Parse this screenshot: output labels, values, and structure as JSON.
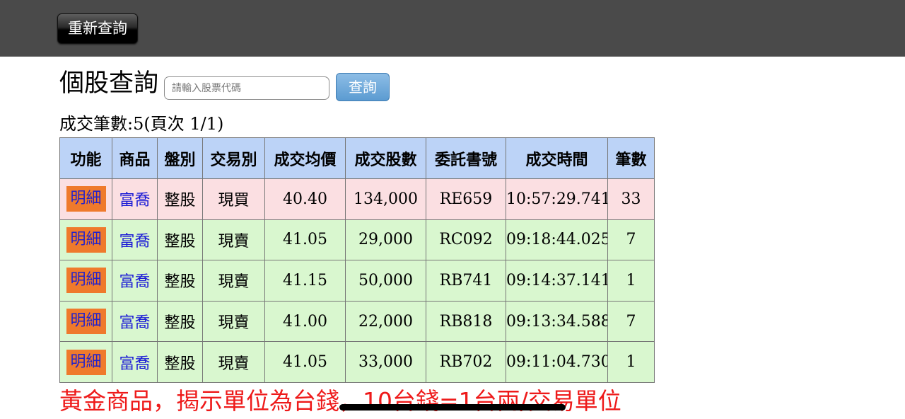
{
  "toolbar": {
    "refresh_label": "重新查詢"
  },
  "search": {
    "title": "個股查詢",
    "placeholder": "請輸入股票代碼",
    "button_label": "查詢"
  },
  "summary": "成交筆數:5(頁次 1/1)",
  "table": {
    "headers": [
      "功能",
      "商品",
      "盤別",
      "交易別",
      "成交均價",
      "成交股數",
      "委託書號",
      "成交時間",
      "筆數"
    ],
    "rows": [
      {
        "action": "明細",
        "product": "富喬",
        "session": "整股",
        "side": "現買",
        "avg_price": "40.40",
        "shares": "134,000",
        "order_no": "RE659",
        "time": "10:57:29.741",
        "count": "33"
      },
      {
        "action": "明細",
        "product": "富喬",
        "session": "整股",
        "side": "現賣",
        "avg_price": "41.05",
        "shares": "29,000",
        "order_no": "RC092",
        "time": "09:18:44.025",
        "count": "7"
      },
      {
        "action": "明細",
        "product": "富喬",
        "session": "整股",
        "side": "現賣",
        "avg_price": "41.15",
        "shares": "50,000",
        "order_no": "RB741",
        "time": "09:14:37.141",
        "count": "1"
      },
      {
        "action": "明細",
        "product": "富喬",
        "session": "整股",
        "side": "現賣",
        "avg_price": "41.00",
        "shares": "22,000",
        "order_no": "RB818",
        "time": "09:13:34.588",
        "count": "7"
      },
      {
        "action": "明細",
        "product": "富喬",
        "session": "整股",
        "side": "現賣",
        "avg_price": "41.05",
        "shares": "33,000",
        "order_no": "RB702",
        "time": "09:11:04.730",
        "count": "1"
      }
    ]
  },
  "notice": "黃金商品，揭示單位為台錢，10台錢=1台兩/交易單位",
  "colors": {
    "buy_row": "#fbdfe2",
    "sell_row": "#d9f7cf",
    "header": "#bcd3f7",
    "notice": "#ee1a1a",
    "detail_button": "#ef7a2c"
  }
}
